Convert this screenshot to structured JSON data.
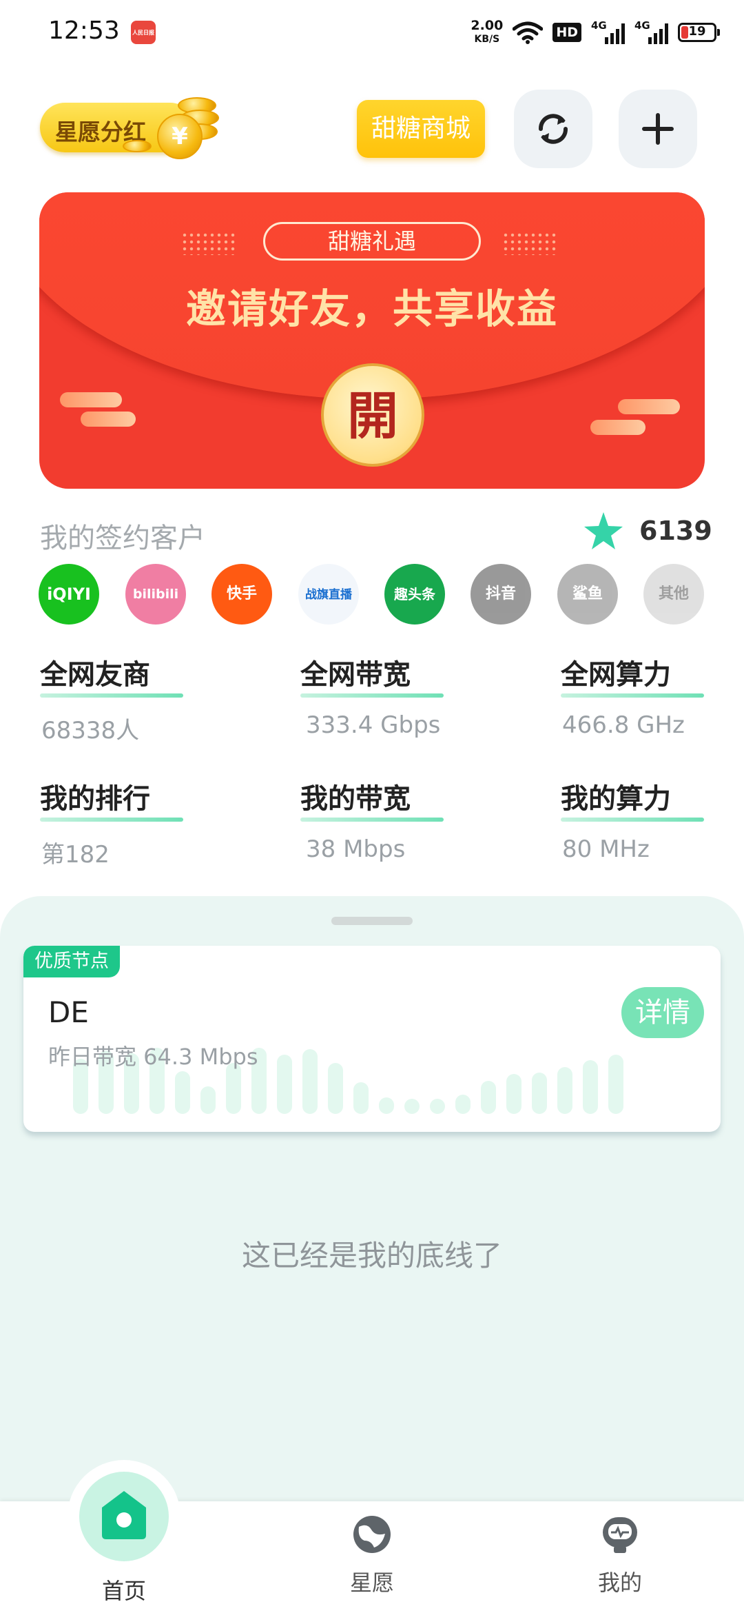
{
  "status_bar": {
    "time": "12:53",
    "news_badge": "人民日报",
    "net_speed_value": "2.00",
    "net_speed_unit": "KB/S",
    "hd_label": "HD",
    "signal_1": "4G",
    "signal_2": "4G",
    "battery": "19"
  },
  "header": {
    "xingyuan_label": "星愿分红",
    "coin_symbol": "¥",
    "mall_label": "甜糖商城"
  },
  "banner": {
    "ribbon_text": "甜糖礼遇",
    "title": "邀请好友，共享收益",
    "seal_text": "開"
  },
  "customers": {
    "title": "我的签约客户",
    "count": "6139",
    "apps": [
      "iQIYI",
      "bilibili",
      "快手",
      "战旗直播",
      "趣头条",
      "抖音",
      "鲨鱼",
      "其他"
    ]
  },
  "stats": [
    {
      "label": "全网友商",
      "value": "68338人"
    },
    {
      "label": "全网带宽",
      "value": "333.4 Gbps"
    },
    {
      "label": "全网算力",
      "value": "466.8 GHz"
    },
    {
      "label": "我的排行",
      "value": "第182"
    },
    {
      "label": "我的带宽",
      "value": "38 Mbps"
    },
    {
      "label": "我的算力",
      "value": "80 MHz"
    }
  ],
  "node": {
    "tag": "优质节点",
    "name": "DE",
    "bandwidth": "昨日带宽 64.3 Mbps",
    "detail_label": "详情"
  },
  "sheet": {
    "bottom_text": "这已经是我的底线了"
  },
  "tabs": [
    {
      "label": "首页",
      "icon": "home-icon"
    },
    {
      "label": "星愿",
      "icon": "planet-icon"
    },
    {
      "label": "我的",
      "icon": "robot-icon"
    }
  ],
  "colors": {
    "accent_green": "#1ec78a",
    "banner_red": "#f23c2f",
    "gold": "#ffc20a"
  }
}
